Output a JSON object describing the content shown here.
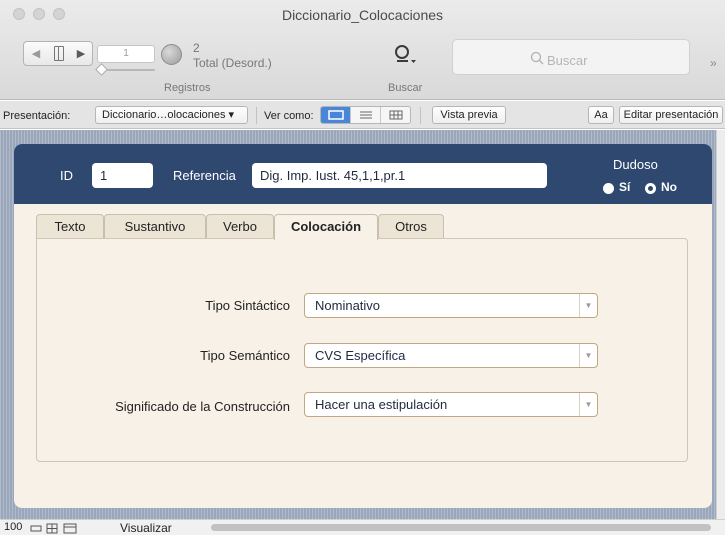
{
  "window": {
    "title": "Diccionario_Colocaciones"
  },
  "toolbar": {
    "record_current": "1",
    "found_count": "2",
    "found_state": "Total (Desord.)",
    "records_label": "Registros",
    "search_label": "Buscar",
    "search_placeholder": "Buscar",
    "more": "»"
  },
  "layout_bar": {
    "layout_label": "Presentación:",
    "layout_value": "Diccionario…olocaciones ▾",
    "view_as_label": "Ver como:",
    "preview_button": "Vista previa",
    "font_button": "Aa",
    "edit_layout_button": "Editar presentación"
  },
  "record": {
    "id_label": "ID",
    "id_value": "1",
    "ref_label": "Referencia",
    "ref_value": "Dig. Imp. Iust. 45,1,1,pr.1",
    "doubtful_label": "Dudoso",
    "doubtful_yes": "Sí",
    "doubtful_no": "No",
    "doubtful_selected": "Sí"
  },
  "tabs": [
    {
      "label": "Texto",
      "active": false
    },
    {
      "label": "Sustantivo",
      "active": false
    },
    {
      "label": "Verbo",
      "active": false
    },
    {
      "label": "Colocación",
      "active": true
    },
    {
      "label": "Otros",
      "active": false
    }
  ],
  "colocacion": {
    "syntactic_label": "Tipo Sintáctico",
    "syntactic_value": "Nominativo",
    "semantic_label": "Tipo Semántico",
    "semantic_value": "CVS Específica",
    "meaning_label": "Significado de la Construcción",
    "meaning_value": "Hacer una estipulación"
  },
  "status": {
    "zoom": "100",
    "mode": "Visualizar"
  },
  "colors": {
    "header": "#2e4870",
    "panel": "#f7f1e7",
    "content_bg": "#9aa7bb",
    "select_border": "#c2a783"
  }
}
